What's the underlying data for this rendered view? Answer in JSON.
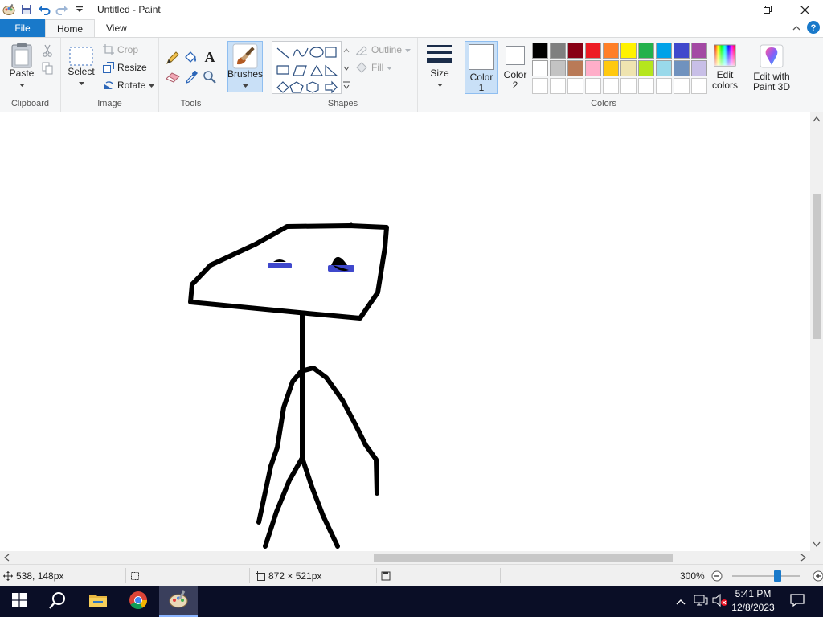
{
  "window": {
    "title": "Untitled - Paint",
    "quick_access": [
      "paint-app-icon",
      "save-icon",
      "undo-icon",
      "redo-icon",
      "customize-dropdown-icon"
    ]
  },
  "tabs": {
    "file": "File",
    "home": "Home",
    "view": "View"
  },
  "ribbon": {
    "clipboard": {
      "label": "Clipboard",
      "paste": "Paste"
    },
    "image": {
      "label": "Image",
      "select": "Select",
      "crop": "Crop",
      "resize": "Resize",
      "rotate": "Rotate"
    },
    "tools": {
      "label": "Tools"
    },
    "brushes": {
      "label": "Brushes"
    },
    "shapes": {
      "label": "Shapes",
      "outline": "Outline",
      "fill": "Fill"
    },
    "size": {
      "label": "Size"
    },
    "colors": {
      "label": "Colors",
      "color1_line1": "Color",
      "color1_line2": "1",
      "color2_line1": "Color",
      "color2_line2": "2",
      "edit_line1": "Edit",
      "edit_line2": "colors",
      "paint3d_line1": "Edit with",
      "paint3d_line2": "Paint 3D",
      "palette_row1": [
        "#000000",
        "#7f7f7f",
        "#880015",
        "#ed1c24",
        "#ff7f27",
        "#fff200",
        "#22b14c",
        "#00a2e8",
        "#3f48cc",
        "#a349a4"
      ],
      "palette_row2": [
        "#ffffff",
        "#c3c3c3",
        "#b97a57",
        "#ffaec9",
        "#ffc90e",
        "#efe4b0",
        "#b5e61d",
        "#99d9ea",
        "#7092be",
        "#c8bfe7"
      ]
    }
  },
  "status": {
    "cursor_pos": "538, 148px",
    "canvas_size": "872 × 521px",
    "zoom": "300%"
  },
  "taskbar": {
    "time": "5:41 PM",
    "date": "12/8/2023"
  },
  "drawing_colors": {
    "stroke": "#000000",
    "eyes": "#3f48cc"
  }
}
